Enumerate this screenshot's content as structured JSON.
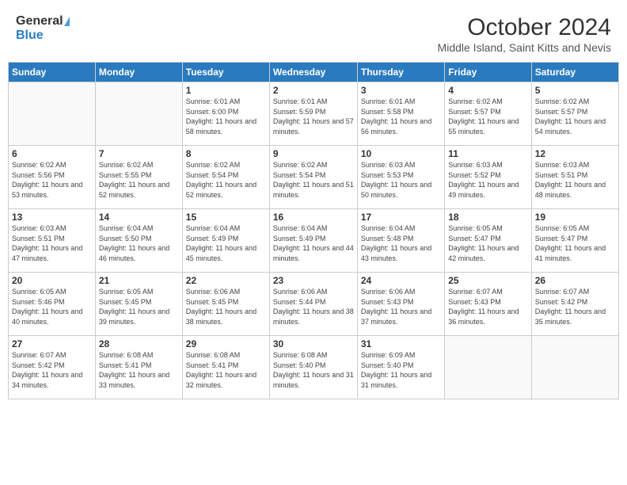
{
  "header": {
    "logo_general": "General",
    "logo_blue": "Blue",
    "month": "October 2024",
    "location": "Middle Island, Saint Kitts and Nevis"
  },
  "weekdays": [
    "Sunday",
    "Monday",
    "Tuesday",
    "Wednesday",
    "Thursday",
    "Friday",
    "Saturday"
  ],
  "weeks": [
    [
      {
        "day": "",
        "info": ""
      },
      {
        "day": "",
        "info": ""
      },
      {
        "day": "1",
        "info": "Sunrise: 6:01 AM\nSunset: 6:00 PM\nDaylight: 11 hours and 58 minutes."
      },
      {
        "day": "2",
        "info": "Sunrise: 6:01 AM\nSunset: 5:59 PM\nDaylight: 11 hours and 57 minutes."
      },
      {
        "day": "3",
        "info": "Sunrise: 6:01 AM\nSunset: 5:58 PM\nDaylight: 11 hours and 56 minutes."
      },
      {
        "day": "4",
        "info": "Sunrise: 6:02 AM\nSunset: 5:57 PM\nDaylight: 11 hours and 55 minutes."
      },
      {
        "day": "5",
        "info": "Sunrise: 6:02 AM\nSunset: 5:57 PM\nDaylight: 11 hours and 54 minutes."
      }
    ],
    [
      {
        "day": "6",
        "info": "Sunrise: 6:02 AM\nSunset: 5:56 PM\nDaylight: 11 hours and 53 minutes."
      },
      {
        "day": "7",
        "info": "Sunrise: 6:02 AM\nSunset: 5:55 PM\nDaylight: 11 hours and 52 minutes."
      },
      {
        "day": "8",
        "info": "Sunrise: 6:02 AM\nSunset: 5:54 PM\nDaylight: 11 hours and 52 minutes."
      },
      {
        "day": "9",
        "info": "Sunrise: 6:02 AM\nSunset: 5:54 PM\nDaylight: 11 hours and 51 minutes."
      },
      {
        "day": "10",
        "info": "Sunrise: 6:03 AM\nSunset: 5:53 PM\nDaylight: 11 hours and 50 minutes."
      },
      {
        "day": "11",
        "info": "Sunrise: 6:03 AM\nSunset: 5:52 PM\nDaylight: 11 hours and 49 minutes."
      },
      {
        "day": "12",
        "info": "Sunrise: 6:03 AM\nSunset: 5:51 PM\nDaylight: 11 hours and 48 minutes."
      }
    ],
    [
      {
        "day": "13",
        "info": "Sunrise: 6:03 AM\nSunset: 5:51 PM\nDaylight: 11 hours and 47 minutes."
      },
      {
        "day": "14",
        "info": "Sunrise: 6:04 AM\nSunset: 5:50 PM\nDaylight: 11 hours and 46 minutes."
      },
      {
        "day": "15",
        "info": "Sunrise: 6:04 AM\nSunset: 5:49 PM\nDaylight: 11 hours and 45 minutes."
      },
      {
        "day": "16",
        "info": "Sunrise: 6:04 AM\nSunset: 5:49 PM\nDaylight: 11 hours and 44 minutes."
      },
      {
        "day": "17",
        "info": "Sunrise: 6:04 AM\nSunset: 5:48 PM\nDaylight: 11 hours and 43 minutes."
      },
      {
        "day": "18",
        "info": "Sunrise: 6:05 AM\nSunset: 5:47 PM\nDaylight: 11 hours and 42 minutes."
      },
      {
        "day": "19",
        "info": "Sunrise: 6:05 AM\nSunset: 5:47 PM\nDaylight: 11 hours and 41 minutes."
      }
    ],
    [
      {
        "day": "20",
        "info": "Sunrise: 6:05 AM\nSunset: 5:46 PM\nDaylight: 11 hours and 40 minutes."
      },
      {
        "day": "21",
        "info": "Sunrise: 6:05 AM\nSunset: 5:45 PM\nDaylight: 11 hours and 39 minutes."
      },
      {
        "day": "22",
        "info": "Sunrise: 6:06 AM\nSunset: 5:45 PM\nDaylight: 11 hours and 38 minutes."
      },
      {
        "day": "23",
        "info": "Sunrise: 6:06 AM\nSunset: 5:44 PM\nDaylight: 11 hours and 38 minutes."
      },
      {
        "day": "24",
        "info": "Sunrise: 6:06 AM\nSunset: 5:43 PM\nDaylight: 11 hours and 37 minutes."
      },
      {
        "day": "25",
        "info": "Sunrise: 6:07 AM\nSunset: 5:43 PM\nDaylight: 11 hours and 36 minutes."
      },
      {
        "day": "26",
        "info": "Sunrise: 6:07 AM\nSunset: 5:42 PM\nDaylight: 11 hours and 35 minutes."
      }
    ],
    [
      {
        "day": "27",
        "info": "Sunrise: 6:07 AM\nSunset: 5:42 PM\nDaylight: 11 hours and 34 minutes."
      },
      {
        "day": "28",
        "info": "Sunrise: 6:08 AM\nSunset: 5:41 PM\nDaylight: 11 hours and 33 minutes."
      },
      {
        "day": "29",
        "info": "Sunrise: 6:08 AM\nSunset: 5:41 PM\nDaylight: 11 hours and 32 minutes."
      },
      {
        "day": "30",
        "info": "Sunrise: 6:08 AM\nSunset: 5:40 PM\nDaylight: 11 hours and 31 minutes."
      },
      {
        "day": "31",
        "info": "Sunrise: 6:09 AM\nSunset: 5:40 PM\nDaylight: 11 hours and 31 minutes."
      },
      {
        "day": "",
        "info": ""
      },
      {
        "day": "",
        "info": ""
      }
    ]
  ]
}
